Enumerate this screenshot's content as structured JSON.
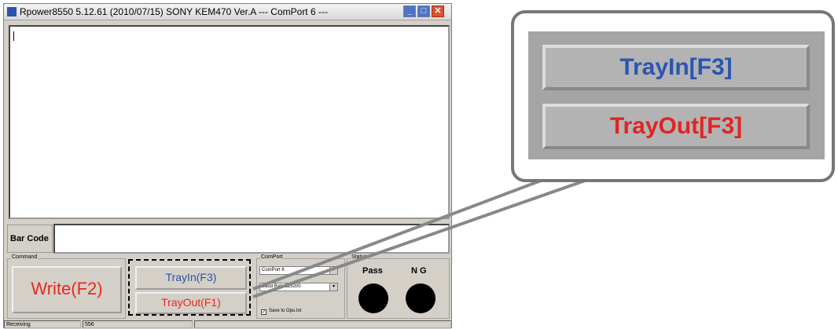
{
  "window": {
    "title": "Rpower8550  5.12.61  (2010/07/15)    SONY  KEM470  Ver.A  ---  ComPort  6  ---",
    "controls": {
      "minimize": "_",
      "maximize": "□",
      "close": "✕"
    }
  },
  "barcode": {
    "label": "Bar Code",
    "value": ""
  },
  "command": {
    "group_label": "Command",
    "write_label": "Write(F2)"
  },
  "tray": {
    "in_label": "TrayIn(F3)",
    "out_label": "TrayOut(F1)"
  },
  "comport": {
    "group_label": "ComPort",
    "port_value": "ComPort 6",
    "baud_value": "Baud Rate 115200",
    "save_label": "Save to Opu.txt",
    "save_checked": "✓"
  },
  "status": {
    "group_label": "Status",
    "pass_label": "Pass",
    "ng_label": "N G"
  },
  "statusbar": {
    "state": "Receiving",
    "value": "556"
  },
  "callout": {
    "in_label": "TrayIn[F3]",
    "out_label": "TrayOut[F3]"
  },
  "colors": {
    "tray_in": "#2d4fa8",
    "tray_out": "#e8281e",
    "write": "#e8281e",
    "callout_in": "#2b55b0",
    "callout_out": "#e02424"
  }
}
